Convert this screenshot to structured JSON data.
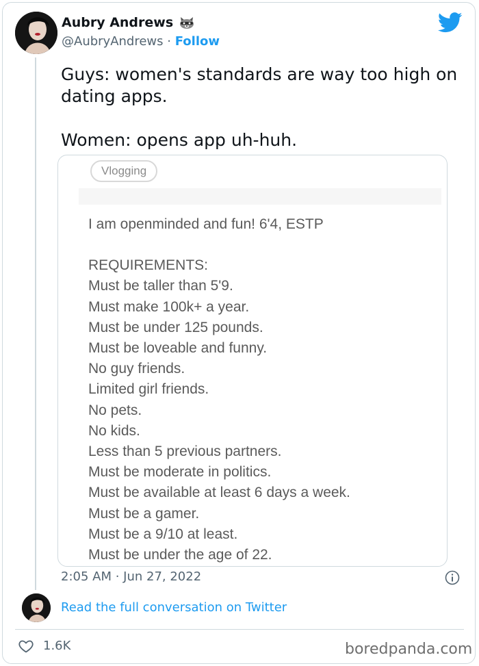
{
  "tweet": {
    "author_name": "Aubry Andrews",
    "handle": "@AubryAndrews",
    "separator": "·",
    "follow_label": "Follow",
    "text_lines": [
      "Guys: women's standards are way too high on dating apps.",
      "Women: opens app uh-huh."
    ],
    "timestamp": "2:05 AM · Jun 27, 2022",
    "read_full_label": "Read the full conversation on Twitter",
    "likes": "1.6K"
  },
  "media": {
    "tag": "Vlogging",
    "bio": "I am openminded and fun! 6'4, ESTP",
    "requirements": [
      "REQUIREMENTS:",
      "Must be taller than 5'9.",
      "Must make 100k+ a year.",
      "Must be under 125 pounds.",
      "Must be loveable and funny.",
      "No guy friends.",
      "Limited girl friends.",
      "No pets.",
      "No kids.",
      "Less than 5 previous partners.",
      "Must be moderate in politics.",
      "Must be available at least 6 days a week.",
      "Must be a gamer.",
      "Must be a 9/10 at least.",
      "Must be under the age of 22."
    ]
  },
  "watermark": "boredpanda.com",
  "colors": {
    "accent": "#1d9bf0",
    "secondary_text": "#536471",
    "border": "#cfd9de"
  },
  "icons": {
    "brand": "twitter-bird-icon",
    "author_badge": "raccoon-icon",
    "info": "info-icon",
    "like": "heart-icon"
  }
}
